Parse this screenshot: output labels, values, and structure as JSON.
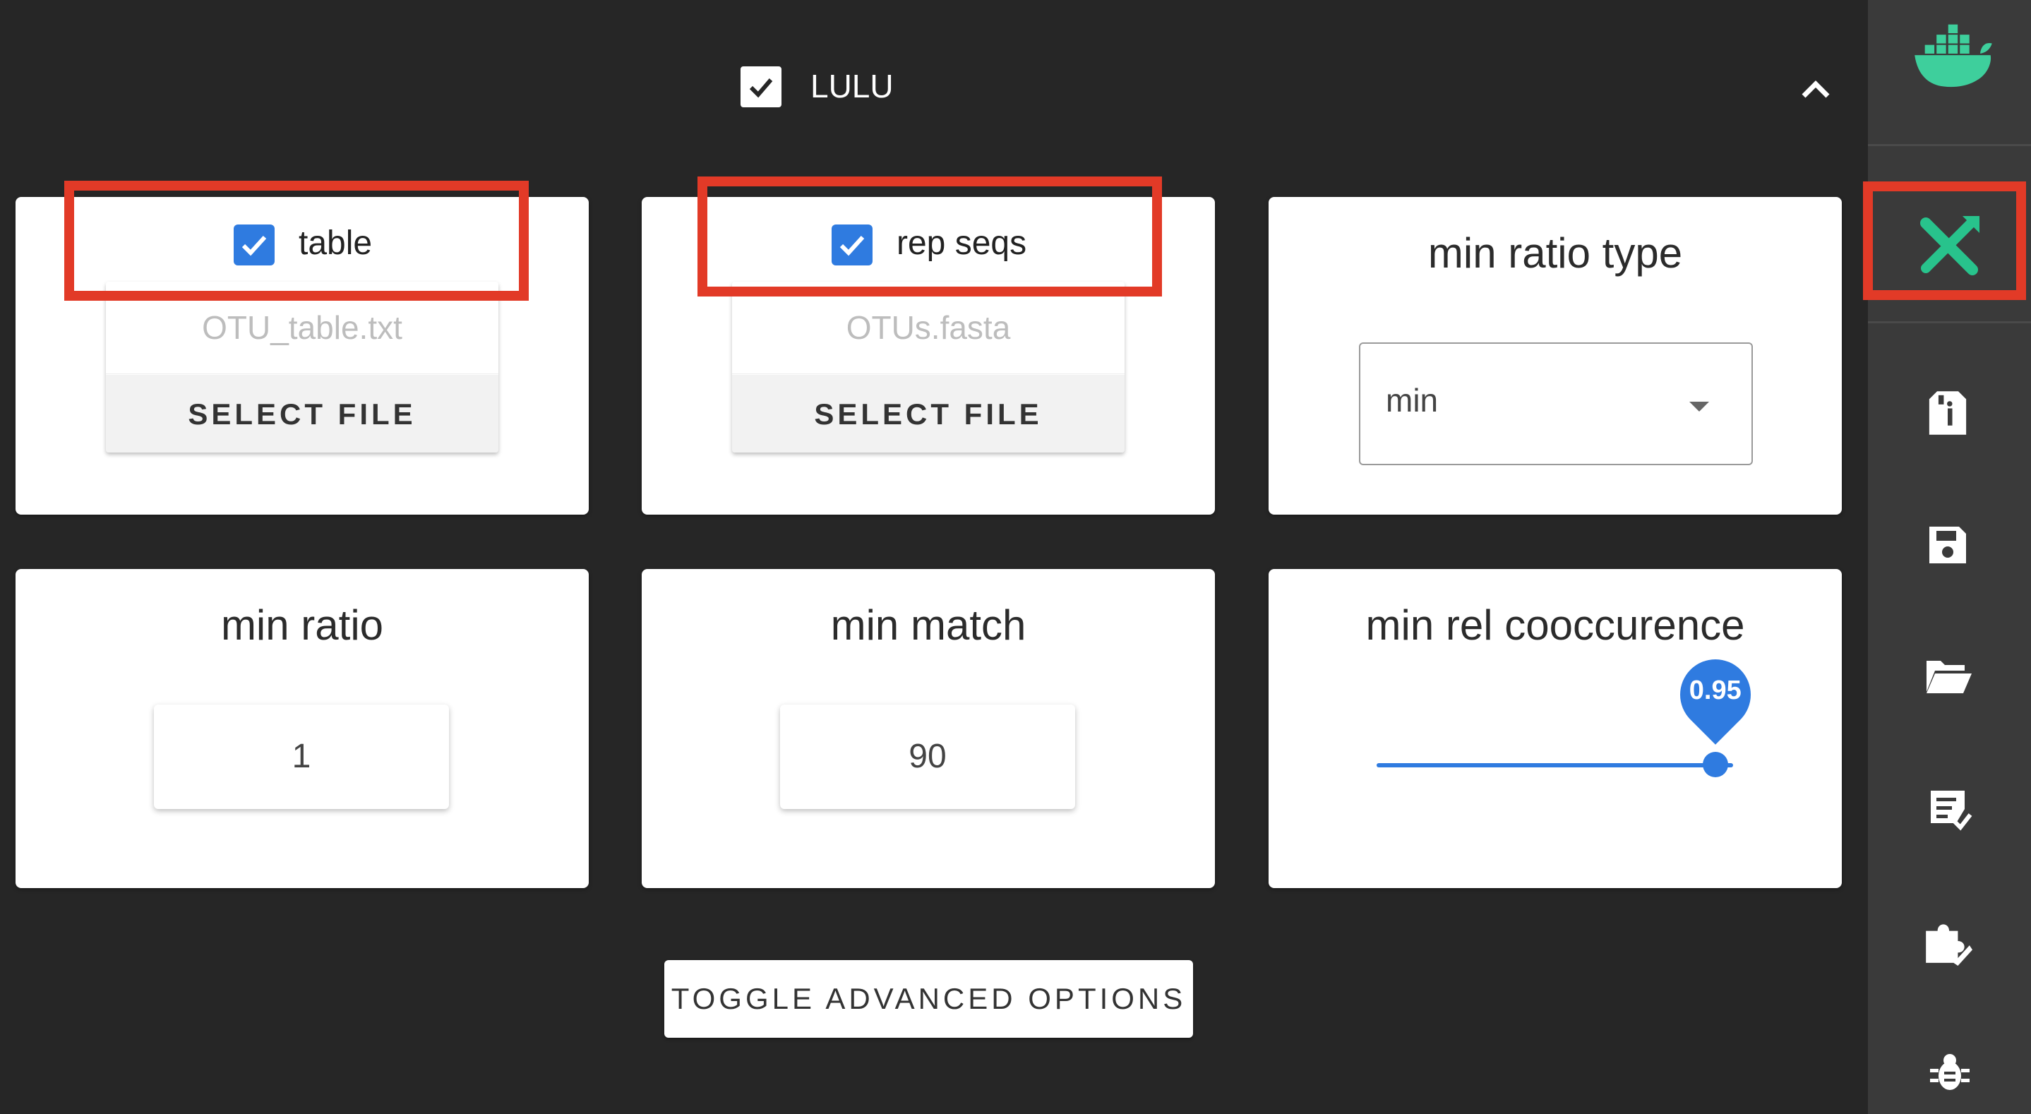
{
  "header": {
    "lulu_checked": true,
    "lulu_label": "LULU",
    "collapse_icon": "chevron-up-icon"
  },
  "cards": {
    "table": {
      "checked": true,
      "label": "table",
      "file_name": "OTU_table.txt",
      "button": "SELECT FILE"
    },
    "rep_seqs": {
      "checked": true,
      "label": "rep seqs",
      "file_name": "OTUs.fasta",
      "button": "SELECT FILE"
    },
    "min_ratio_type": {
      "title": "min ratio type",
      "value": "min"
    },
    "min_ratio": {
      "title": "min ratio",
      "value": "1"
    },
    "min_match": {
      "title": "min match",
      "value": "90"
    },
    "min_rel_cooccurence": {
      "title": "min rel cooccurence",
      "value": "0.95",
      "fraction": 0.95
    }
  },
  "toggle_advanced_label": "TOGGLE ADVANCED OPTIONS",
  "sidebar": {
    "icons": [
      "docker-icon",
      "tools-icon",
      "file-info-icon",
      "save-icon",
      "folder-open-icon",
      "checklist-icon",
      "puzzle-edit-icon",
      "bug-icon"
    ],
    "active": "tools-icon"
  },
  "colors": {
    "background": "#262626",
    "sidebar": "#3a3a3a",
    "accent": "#2f7be0",
    "highlight": "#e23a27",
    "docker": "#3ecf9c",
    "active_icon": "#28c38c"
  }
}
